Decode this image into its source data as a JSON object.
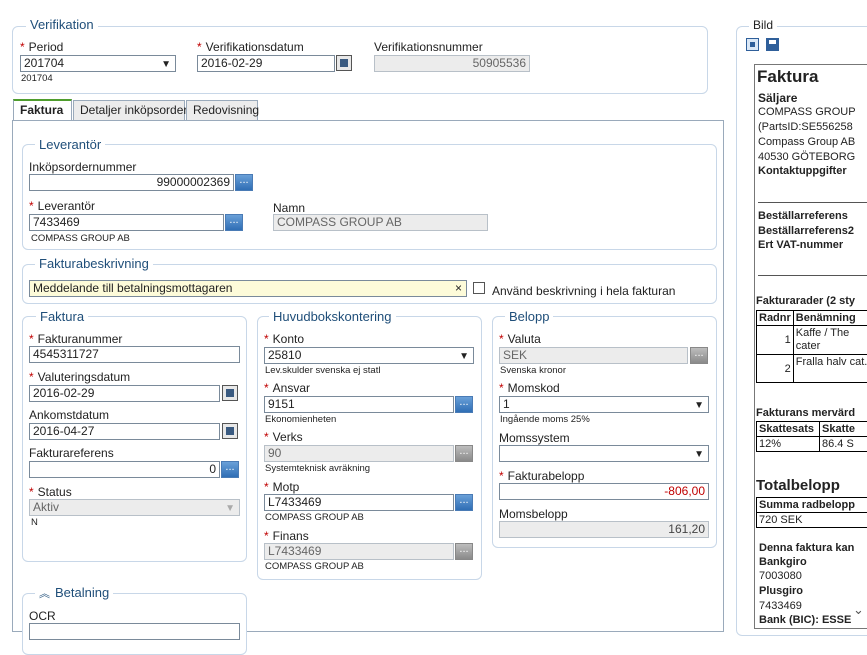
{
  "verifikation": {
    "legend": "Verifikation",
    "period_label": "Period",
    "period_value": "201704",
    "period_sub": "201704",
    "datum_label": "Verifikationsdatum",
    "datum_value": "2016-02-29",
    "nummer_label": "Verifikationsnummer",
    "nummer_value": "50905536"
  },
  "tabs": [
    "Faktura",
    "Detaljer inköpsorder",
    "Redovisning"
  ],
  "leverantor": {
    "legend": "Leverantör",
    "inkop_label": "Inköpsordernummer",
    "inkop_value": "99000002369",
    "lev_label": "Leverantör",
    "lev_value": "7433469",
    "lev_sub": "COMPASS GROUP AB",
    "namn_label": "Namn",
    "namn_value": "COMPASS GROUP AB"
  },
  "beskrivning": {
    "legend": "Fakturabeskrivning",
    "value": "Meddelande till betalningsmottagaren",
    "clear": "×",
    "checkbox_label": "Använd beskrivning i hela fakturan"
  },
  "faktura": {
    "legend": "Faktura",
    "nummer_label": "Fakturanummer",
    "nummer_value": "4545311727",
    "valdatum_label": "Valuteringsdatum",
    "valdatum_value": "2016-02-29",
    "ankomst_label": "Ankomstdatum",
    "ankomst_value": "2016-04-27",
    "ref_label": "Fakturareferens",
    "ref_value": "0",
    "status_label": "Status",
    "status_value": "Aktiv",
    "status_sub": "N"
  },
  "huvudbok": {
    "legend": "Huvudbokskontering",
    "konto_label": "Konto",
    "konto_value": "25810",
    "konto_sub": "Lev.skulder svenska ej statl",
    "ansvar_label": "Ansvar",
    "ansvar_value": "9151",
    "ansvar_sub": "Ekonomienheten",
    "verks_label": "Verks",
    "verks_value": "90",
    "verks_sub": "Systemteknisk avräkning",
    "motp_label": "Motp",
    "motp_value": "L7433469",
    "motp_sub": "COMPASS GROUP AB",
    "finans_label": "Finans",
    "finans_value": "L7433469",
    "finans_sub": "COMPASS GROUP AB"
  },
  "belopp": {
    "legend": "Belopp",
    "valuta_label": "Valuta",
    "valuta_value": "SEK",
    "valuta_sub": "Svenska kronor",
    "momskod_label": "Momskod",
    "momskod_value": "1",
    "momskod_sub": "Ingående moms 25%",
    "momssystem_label": "Momssystem",
    "momssystem_value": "",
    "fakturabelopp_label": "Fakturabelopp",
    "fakturabelopp_value": "-806,00",
    "momsbelopp_label": "Momsbelopp",
    "momsbelopp_value": "161,20"
  },
  "betalning": {
    "legend": "Betalning",
    "ocr_label": "OCR"
  },
  "bild": {
    "legend": "Bild",
    "doc": {
      "title": "Faktura",
      "saljare": "Säljare",
      "s1": "COMPASS GROUP",
      "s2": "(PartsID:SE556258",
      "s3": "Compass Group AB",
      "s4": "40530 GÖTEBORG",
      "kontakt": "Kontaktuppgifter",
      "best1": "Beställarreferens",
      "best2": "Beställarreferens2",
      "vat": "Ert VAT-nummer",
      "rader_title": "Fakturarader (2 sty",
      "rader_headers": [
        "Radnr",
        "Benämning"
      ],
      "rader": [
        [
          "1",
          "Kaffe / The cater"
        ],
        [
          "2",
          "Fralla halv cat."
        ]
      ],
      "merv_title": "Fakturans mervärd",
      "merv_headers": [
        "Skattesats",
        "Skatte"
      ],
      "merv_row": [
        "12%",
        "86.4 S"
      ],
      "total_title": "Totalbelopp",
      "total_header": "Summa radbelopp",
      "total_value": "720 SEK",
      "denna": "Denna faktura kan",
      "bankgiro_label": "Bankgiro",
      "bankgiro": "7003080",
      "plusgiro_label": "Plusgiro",
      "plusgiro": "7433469",
      "bic": "Bank (BIC): ESSE"
    }
  }
}
